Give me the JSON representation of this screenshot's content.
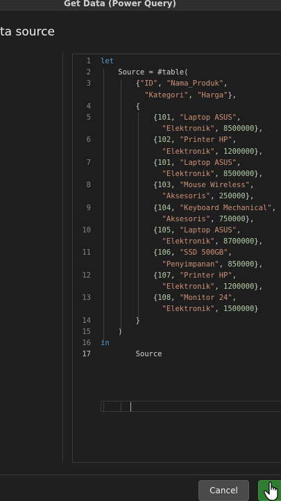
{
  "window": {
    "title": "Get Data (Power Query)"
  },
  "dialog": {
    "heading": "ta source"
  },
  "editor": {
    "line_numbers": [
      "1",
      "2",
      "3",
      "4",
      "5",
      "6",
      "7",
      "8",
      "9",
      "10",
      "11",
      "12",
      "13",
      "14",
      "15",
      "16",
      "17"
    ],
    "active_line": "17",
    "lines": [
      {
        "number": "1",
        "text": "let"
      },
      {
        "number": "2",
        "text": "    Source = #table("
      },
      {
        "number": "3",
        "text": "        {\"ID\", \"Nama_Produk\",",
        "cont": "          \"Kategori\", \"Harga\"},"
      },
      {
        "number": "4",
        "text": "        {"
      },
      {
        "number": "5",
        "text": "            {101, \"Laptop ASUS\",",
        "cont": "              \"Elektronik\", 8500000},"
      },
      {
        "number": "6",
        "text": "            {102, \"Printer HP\",",
        "cont": "              \"Elektronik\", 1200000},"
      },
      {
        "number": "7",
        "text": "            {101, \"Laptop ASUS\",",
        "cont": "              \"Elektronik\", 8500000},"
      },
      {
        "number": "8",
        "text": "            {103, \"Mouse Wireless\",",
        "cont": "              \"Aksesoris\", 250000},"
      },
      {
        "number": "9",
        "text": "            {104, \"Keyboard Mechanical\",",
        "cont": "              \"Aksesoris\", 750000},"
      },
      {
        "number": "10",
        "text": "            {105, \"Laptop ASUS\",",
        "cont": "              \"Elektronik\", 8700000},"
      },
      {
        "number": "11",
        "text": "            {106, \"SSD 500GB\",",
        "cont": "              \"Penyimpanan\", 850000},"
      },
      {
        "number": "12",
        "text": "            {107, \"Printer HP\",",
        "cont": "              \"Elektronik\", 1200000},"
      },
      {
        "number": "13",
        "text": "            {108, \"Monitor 24\",",
        "cont": "              \"Elektronik\", 1500000}"
      },
      {
        "number": "14",
        "text": "        }"
      },
      {
        "number": "15",
        "text": "    )"
      },
      {
        "number": "16",
        "text": "in"
      },
      {
        "number": "17",
        "text": "        Source"
      }
    ]
  },
  "footer": {
    "cancel_label": "Cancel"
  },
  "colors": {
    "keyword": "#569cd6",
    "string": "#ce9178",
    "number": "#b5cea8",
    "ok_button": "#2f7d33"
  }
}
